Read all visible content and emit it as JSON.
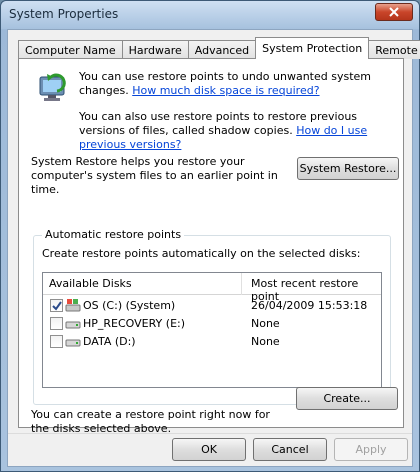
{
  "window": {
    "title": "System Properties"
  },
  "tabs": [
    {
      "label": "Computer Name",
      "active": false
    },
    {
      "label": "Hardware",
      "active": false
    },
    {
      "label": "Advanced",
      "active": false
    },
    {
      "label": "System Protection",
      "active": true
    },
    {
      "label": "Remote",
      "active": false
    }
  ],
  "info": {
    "line1_text": "You can use restore points to undo unwanted system changes.",
    "line1_link": "How much disk space is required?",
    "line2_text": "You can also use restore points to restore previous versions of files, called shadow copies.",
    "line2_link": "How do I use previous versions?"
  },
  "restore": {
    "description": "System Restore helps you restore your computer's system files to an earlier point in time.",
    "button_label": "System Restore..."
  },
  "auto_restore": {
    "group_label": "Automatic restore points",
    "description": "Create restore points automatically on the selected disks:",
    "columns": [
      "Available Disks",
      "Most recent restore point"
    ],
    "disks": [
      {
        "name": "OS (C:) (System)",
        "recent": "26/04/2009 15:53:18",
        "checked": true,
        "icon": "system-drive-icon"
      },
      {
        "name": "HP_RECOVERY (E:)",
        "recent": "None",
        "checked": false,
        "icon": "drive-icon"
      },
      {
        "name": "DATA (D:)",
        "recent": "None",
        "checked": false,
        "icon": "drive-icon"
      }
    ]
  },
  "create": {
    "description": "You can create a restore point right now for the disks selected above.",
    "button_label": "Create..."
  },
  "footer": {
    "ok_label": "OK",
    "cancel_label": "Cancel",
    "apply_label": "Apply"
  },
  "colors": {
    "link": "#0645d8",
    "titlebar": "#a6c1de",
    "close": "#c9452a"
  }
}
